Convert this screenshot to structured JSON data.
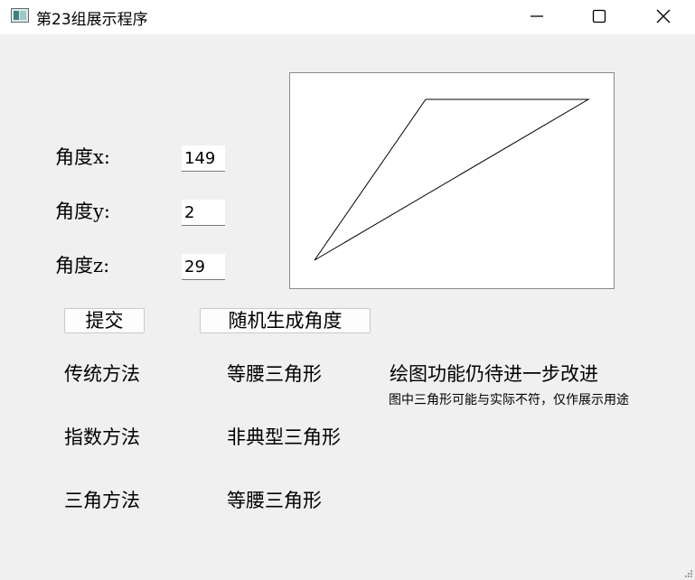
{
  "window": {
    "title": "第23组展示程序",
    "minimize_icon": "minimize-icon",
    "maximize_icon": "maximize-icon",
    "close_icon": "close-icon"
  },
  "form": {
    "label_x": "角度x:",
    "label_y": "角度y:",
    "label_z": "角度z:",
    "value_x": "149",
    "value_y": "2",
    "value_z": "29"
  },
  "buttons": {
    "submit": "提交",
    "random": "随机生成角度"
  },
  "results": [
    {
      "method": "传统方法",
      "result": "等腰三角形"
    },
    {
      "method": "指数方法",
      "result": "非典型三角形"
    },
    {
      "method": "三角方法",
      "result": "等腰三角形"
    }
  ],
  "notes": {
    "headline": "绘图功能仍待进一步改进",
    "detail": "图中三角形可能与实际不符，仅作展示用途"
  }
}
